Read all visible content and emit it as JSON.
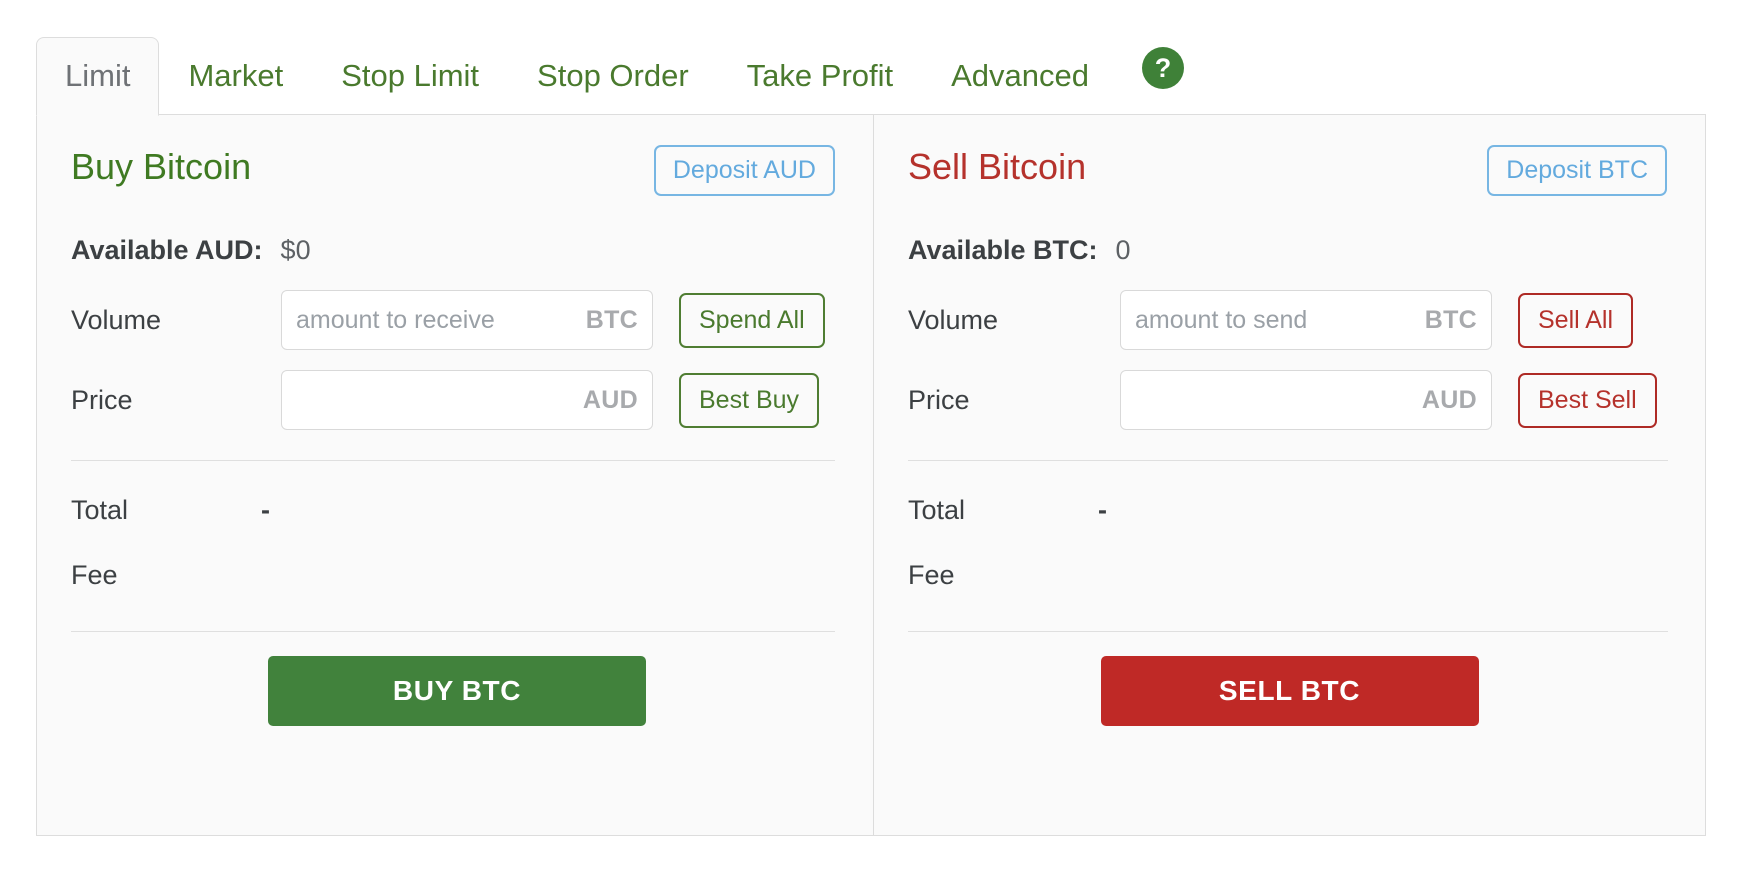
{
  "tabs": [
    {
      "label": "Limit",
      "active": true
    },
    {
      "label": "Market",
      "active": false
    },
    {
      "label": "Stop Limit",
      "active": false
    },
    {
      "label": "Stop Order",
      "active": false
    },
    {
      "label": "Take Profit",
      "active": false
    },
    {
      "label": "Advanced",
      "active": false
    }
  ],
  "help": {
    "icon": "help-question-icon",
    "glyph": "?"
  },
  "colors": {
    "buy_green": "#41823c",
    "sell_red": "#bf2926",
    "deposit_blue": "#63aade",
    "tab_green": "#4a7a2e",
    "active_tab_text": "#6f7276"
  },
  "buy": {
    "title": "Buy Bitcoin",
    "deposit_label": "Deposit AUD",
    "available_label": "Available AUD:",
    "available_value": "$0",
    "volume_label": "Volume",
    "volume_placeholder": "amount to receive",
    "volume_value": "",
    "volume_suffix": "BTC",
    "volume_action": "Spend All",
    "price_label": "Price",
    "price_placeholder": "",
    "price_value": "",
    "price_suffix": "AUD",
    "price_action": "Best Buy",
    "total_label": "Total",
    "total_value": "-",
    "fee_label": "Fee",
    "fee_value": "",
    "submit_label": "BUY BTC"
  },
  "sell": {
    "title": "Sell Bitcoin",
    "deposit_label": "Deposit BTC",
    "available_label": "Available BTC:",
    "available_value": "0",
    "volume_label": "Volume",
    "volume_placeholder": "amount to send",
    "volume_value": "",
    "volume_suffix": "BTC",
    "volume_action": "Sell All",
    "price_label": "Price",
    "price_placeholder": "",
    "price_value": "",
    "price_suffix": "AUD",
    "price_action": "Best Sell",
    "total_label": "Total",
    "total_value": "-",
    "fee_label": "Fee",
    "fee_value": "",
    "submit_label": "SELL BTC"
  }
}
